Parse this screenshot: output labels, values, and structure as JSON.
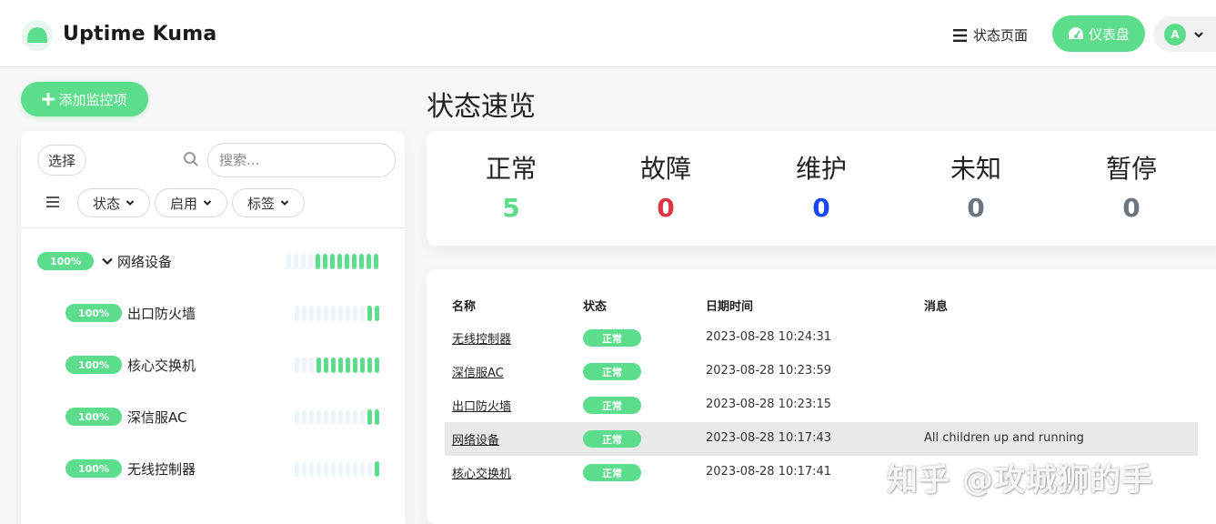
{
  "header": {
    "brand": "Uptime Kuma",
    "status_page_label": "状态页面",
    "dashboard_label": "仪表盘",
    "avatar_letter": "A"
  },
  "sidebar": {
    "add_label": "添加监控项",
    "select_label": "选择",
    "search_placeholder": "搜索...",
    "filters": [
      {
        "label": "状态"
      },
      {
        "label": "启用"
      },
      {
        "label": "标签"
      }
    ],
    "monitors": [
      {
        "name": "网络设备",
        "percent": "100%",
        "group": true,
        "beats_up": 9
      },
      {
        "name": "出口防火墙",
        "percent": "100%",
        "group": false,
        "beats_up": 2
      },
      {
        "name": "核心交换机",
        "percent": "100%",
        "group": false,
        "beats_up": 9
      },
      {
        "name": "深信服AC",
        "percent": "100%",
        "group": false,
        "beats_up": 2
      },
      {
        "name": "无线控制器",
        "percent": "100%",
        "group": false,
        "beats_up": 1
      }
    ]
  },
  "main": {
    "title": "状态速览",
    "stats": [
      {
        "label": "正常",
        "value": "5",
        "color": "#5cdd8b"
      },
      {
        "label": "故障",
        "value": "0",
        "color": "#dc3545"
      },
      {
        "label": "维护",
        "value": "0",
        "color": "#1747f5"
      },
      {
        "label": "未知",
        "value": "0",
        "color": "#6c757d"
      },
      {
        "label": "暂停",
        "value": "0",
        "color": "#6c757d"
      }
    ],
    "table": {
      "headers": {
        "name": "名称",
        "status": "状态",
        "time": "日期时间",
        "message": "消息"
      },
      "rows": [
        {
          "name": "无线控制器",
          "status": "正常",
          "time": "2023-08-28 10:24:31",
          "message": ""
        },
        {
          "name": "深信服AC",
          "status": "正常",
          "time": "2023-08-28 10:23:59",
          "message": ""
        },
        {
          "name": "出口防火墙",
          "status": "正常",
          "time": "2023-08-28 10:23:15",
          "message": ""
        },
        {
          "name": "网络设备",
          "status": "正常",
          "time": "2023-08-28 10:17:43",
          "message": "All children up and running"
        },
        {
          "name": "核心交换机",
          "status": "正常",
          "time": "2023-08-28 10:17:41",
          "message": ""
        }
      ]
    }
  },
  "watermark": "知乎 @攻城狮的手",
  "colors": {
    "accent": "#5cdd8b"
  }
}
